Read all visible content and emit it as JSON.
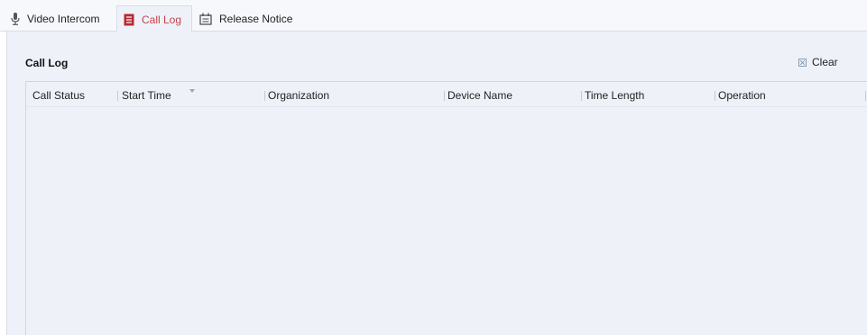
{
  "tabs": [
    {
      "label": "Video Intercom",
      "icon": "microphone-icon",
      "active": false
    },
    {
      "label": "Call Log",
      "icon": "document-icon",
      "active": true
    },
    {
      "label": "Release Notice",
      "icon": "notice-board-icon",
      "active": false
    }
  ],
  "panel": {
    "title": "Call Log",
    "clear_label": "Clear",
    "clear_icon": "clear-icon"
  },
  "table": {
    "columns": [
      "Call Status",
      "Start Time",
      "Organization",
      "Device Name",
      "Time Length",
      "Operation"
    ],
    "sorted_column": "Start Time",
    "sort_direction": "descending",
    "rows": []
  },
  "colors": {
    "active_tab_text": "#c8414b",
    "panel_background": "#eef2f8"
  }
}
